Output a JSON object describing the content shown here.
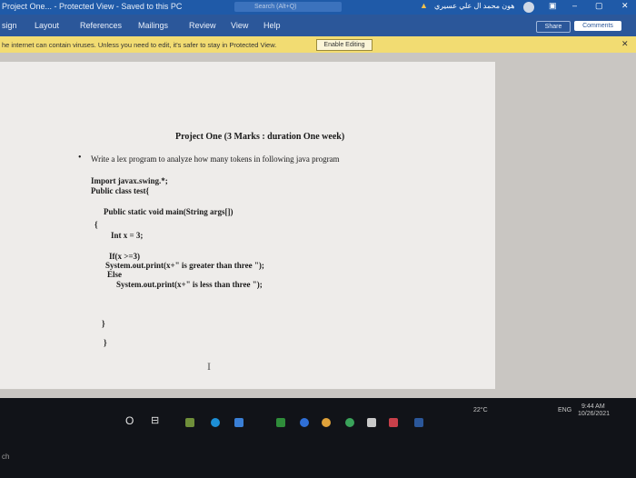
{
  "titlebar": {
    "title": "Project One...   -  Protected View  -  Saved to this PC",
    "search": "Search (Alt+Q)",
    "user": "هون محمد ال علي عسيري",
    "warning_icon": "warning-icon",
    "controls": [
      "▣",
      "–",
      "▢",
      "✕"
    ]
  },
  "ribbon": {
    "tabs": [
      "sign",
      "Layout",
      "References",
      "Mailings",
      "Review",
      "View",
      "Help"
    ],
    "share_label": "Share",
    "comments_label": "Comments"
  },
  "protected_view": {
    "message": "he internet can contain viruses. Unless you need to edit, it's safer to stay in Protected View.",
    "enable_label": "Enable Editing",
    "close_glyph": "✕"
  },
  "document": {
    "title": "Project One (3 Marks  : duration One week)",
    "bullet_glyph": "•",
    "bullet_text": "Write  a lex program  to analyze how many  tokens  in  following java  program",
    "code_lines": [
      "Import javax.swing.*;",
      "Public class  test{",
      "Public static void main(String args[])",
      "{",
      "Int x = 3;",
      "If(x >=3)",
      "System.out.print(x+\"  is greater than three  \");",
      "Else",
      "System.out.print(x+\"  is less than three  \");",
      "}",
      "}"
    ],
    "cursor_glyph": "I"
  },
  "taskbar": {
    "search_glyph": "O",
    "taskview_glyph": "⊟",
    "weather": "22°C",
    "lang": "ENG",
    "time": "9:44 AM",
    "date": "10/26/2021",
    "left_label": "ch"
  },
  "colors": {
    "titlebar": "#1f5aa8",
    "ribbon": "#2b579a",
    "protected_bar": "#f2dc72",
    "page": "#eeecea"
  }
}
